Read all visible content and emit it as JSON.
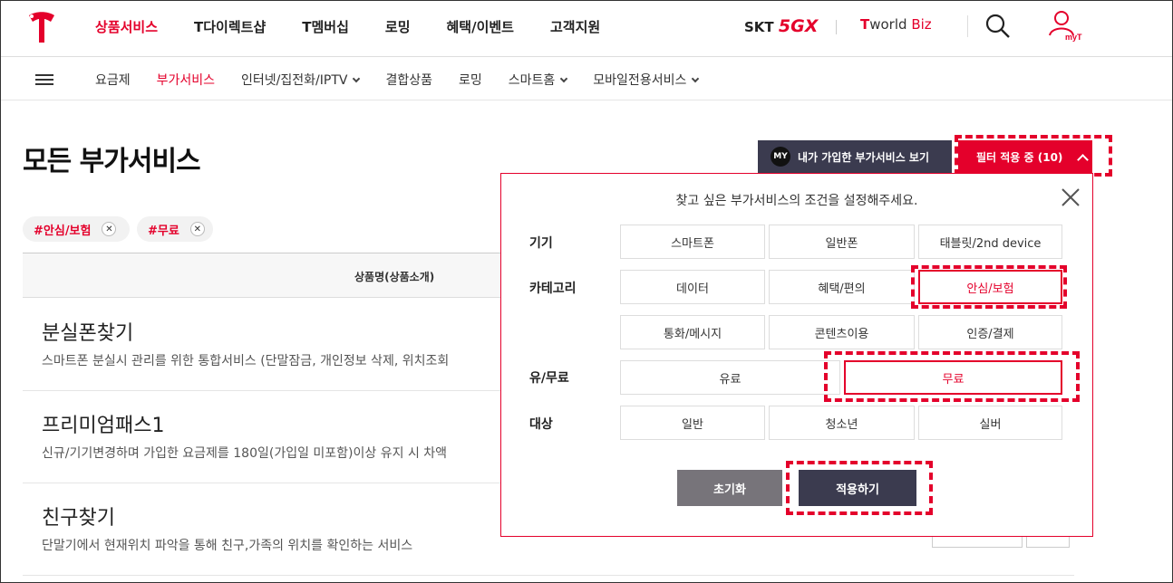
{
  "header": {
    "nav": [
      "상품서비스",
      "T다이렉트샵",
      "T멤버십",
      "로밍",
      "혜택/이벤트",
      "고객지원"
    ],
    "skt_prefix": "SKT",
    "skt_5gx": "5GX",
    "worldbiz_prefix": "T",
    "worldbiz_world": "world",
    "worldbiz_biz": "Biz",
    "myt_label": "myT"
  },
  "subnav": [
    "요금제",
    "부가서비스",
    "인터넷/집전화/IPTV",
    "결합상품",
    "로밍",
    "스마트홈",
    "모바일전용서비스"
  ],
  "page": {
    "title": "모든 부가서비스",
    "my_badge": "MY",
    "my_button": "내가 가입한 부가서비스 보기",
    "filter_button": "필터 적용 중 (10)"
  },
  "tags": [
    "#안심/보험",
    "#무료"
  ],
  "table": {
    "header": "상품명(상품소개)",
    "rows": [
      {
        "name": "분실폰찾기",
        "desc": "스마트폰 분실시 관리를 위한 통합서비스 (단말잠금, 개인정보 삭제, 위치조회"
      },
      {
        "name": "프리미엄패스1",
        "desc": "신규/기기변경하며 가입한 요금제를 180일(가입일 미포함)이상 유지 시 차액"
      },
      {
        "name": "친구찾기",
        "desc": "단말기에서 현재위치 파악을 통해 친구,가족의 위치를 확인하는 서비스"
      }
    ]
  },
  "filter": {
    "heading": "찾고 싶은 부가서비스의 조건을 설정해주세요.",
    "labels": {
      "device": "기기",
      "category": "카테고리",
      "price": "유/무료",
      "target": "대상"
    },
    "device": [
      "스마트폰",
      "일반폰",
      "태블릿/2nd device"
    ],
    "category": [
      "데이터",
      "혜택/편의",
      "안심/보험",
      "통화/메시지",
      "콘텐츠이용",
      "인증/결제"
    ],
    "price": [
      "유료",
      "무료"
    ],
    "target": [
      "일반",
      "청소년",
      "실버"
    ],
    "reset": "초기화",
    "apply": "적용하기"
  }
}
